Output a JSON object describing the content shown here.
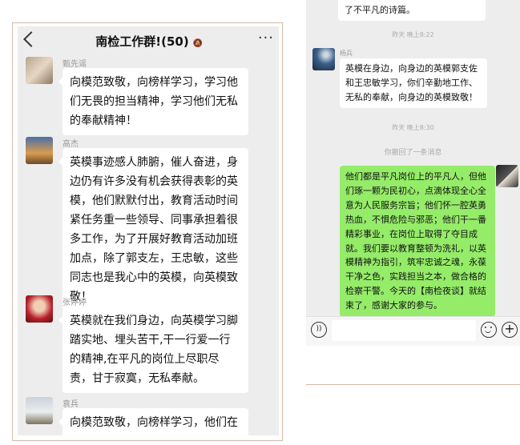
{
  "left": {
    "title": "南检工作群!(50)",
    "messages": [
      {
        "sender": "甄先谣",
        "text": "向模范致敬，向榜样学习，学习他们无畏的担当精神，学习他们无私的奉献精神！"
      },
      {
        "sender": "高杰",
        "text": "英模事迹感人肺腑，催人奋进，身边仍有许多没有机会获得表彰的英模，他们默默付出，教育活动时间紧任务重一些领导、同事承担着很多工作，为了开展好教育活动加班加点，除了郭支左，王忠敏，这些同志也是我心中的英模，向英模致敬！"
      },
      {
        "sender": "张婷婷",
        "text": "英模就在我们身边，向英模学习脚踏实地、埋头苦干,干一行爱一行的精神,在平凡的岗位上尽职尽责，甘于寂寞，无私奉献。"
      },
      {
        "sender": "袁兵",
        "text": "向模范致敬，向榜样学习，他们在平凡的岗位做着平凡的工作，日十"
      }
    ]
  },
  "right": {
    "top_text": "了不平凡的诗篇。",
    "time1": "昨天 晚上8:22",
    "msg1_sender": "杨兵",
    "msg1_text": "英模在身边，向身边的英模郭支佐和王忠敏学习，你们辛勤地工作、无私的奉献，向身边的英模致敬！",
    "time2": "昨天 晚上8:30",
    "recall": "你撤回了一条消息",
    "own_text": "他们都是平凡岗位上的平凡人，但他们琢一颗为民初心，点滴体现全心全意为人民服务宗旨；他们怀一腔英勇热血，不惧危险与邪恶；他们干一番精彩事业，在岗位上取得了夺目成就。我们要以教育整顿为洗礼，以英模精神为指引，筑牢忠诚之魂，永葆干净之色，实践担当之本，做合格的检察干警。今天的【南检夜谈】就结束了，感谢大家的参与。"
  }
}
